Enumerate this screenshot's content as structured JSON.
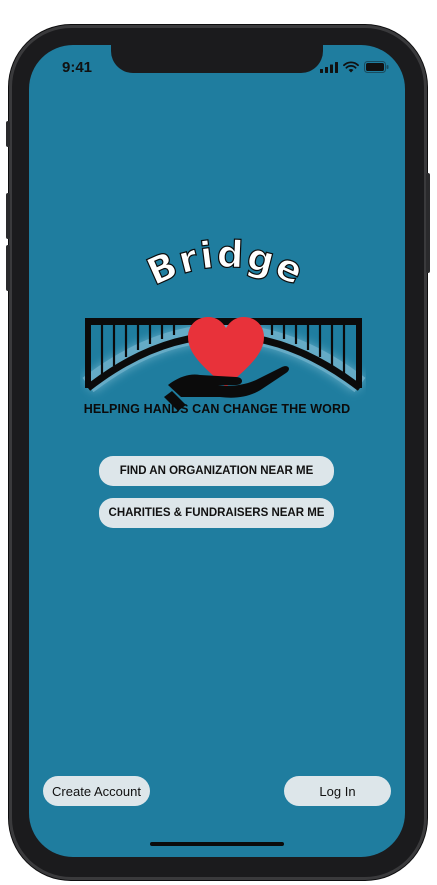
{
  "status_bar": {
    "time": "9:41",
    "icons": [
      "cellular-signal-icon",
      "wifi-icon",
      "battery-icon"
    ]
  },
  "logo": {
    "wordmark": "Bridge",
    "icon_description": "bridge with heart and hand"
  },
  "tagline": "HELPING HANDS CAN CHANGE THE WORD",
  "actions": {
    "find_org_label": "FIND AN ORGANIZATION NEAR ME",
    "charities_label": "CHARITIES & FUNDRAISERS NEAR ME"
  },
  "footer": {
    "create_account_label": "Create Account",
    "login_label": "Log In"
  },
  "colors": {
    "screen_background": "#1f7d9f",
    "button_background": "#dde6ea",
    "heart": "#e8323a",
    "frame": "#1b1b1d"
  }
}
